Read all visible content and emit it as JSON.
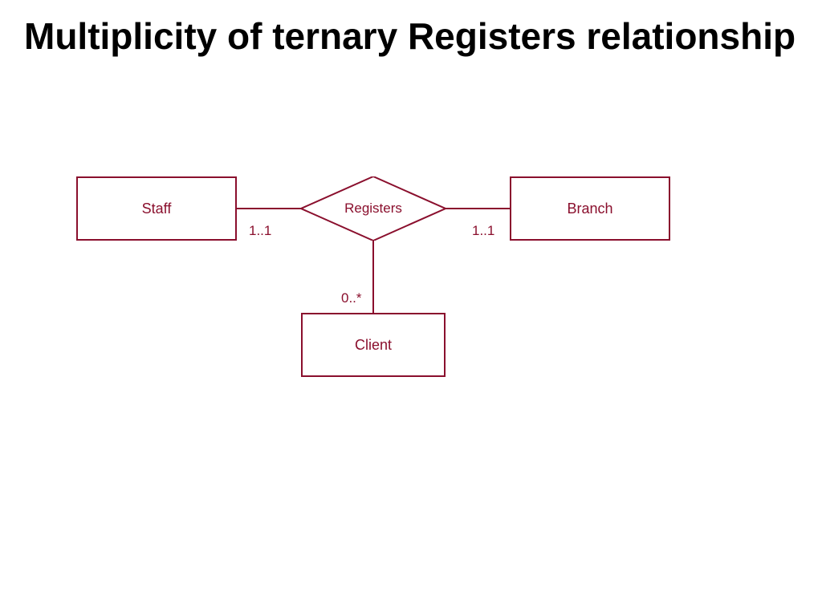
{
  "title": "Multiplicity of ternary Registers relationship",
  "entities": {
    "staff": "Staff",
    "branch": "Branch",
    "client": "Client"
  },
  "relationship": {
    "name": "Registers"
  },
  "multiplicities": {
    "staff_side": "1..1",
    "branch_side": "1..1",
    "client_side": "0..*"
  },
  "colors": {
    "primary": "#8a0f2d"
  }
}
